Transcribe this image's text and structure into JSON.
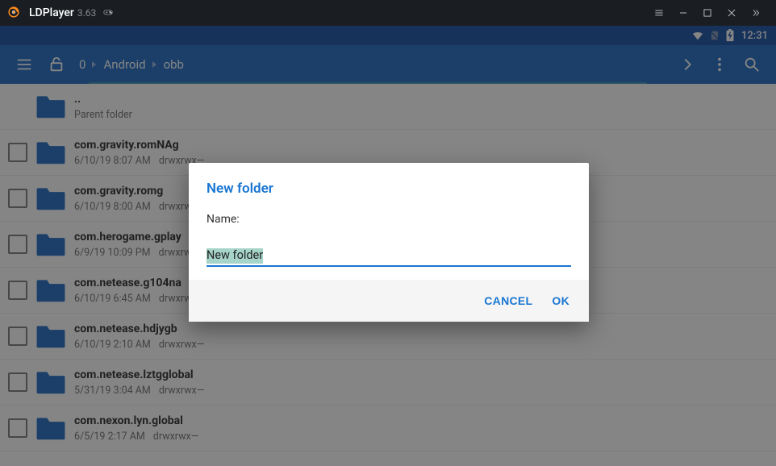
{
  "titlebar": {
    "appname": "LDPlayer",
    "version": "3.63"
  },
  "statusbar": {
    "time": "12:31"
  },
  "toolbar": {
    "breadcrumb": [
      "0",
      "Android",
      "obb"
    ]
  },
  "files": [
    {
      "name": "..",
      "sub1": "Parent folder",
      "sub2": "",
      "parent": true
    },
    {
      "name": "com.gravity.romNAg",
      "sub1": "6/10/19 8:07 AM",
      "sub2": "drwxrwx—"
    },
    {
      "name": "com.gravity.romg",
      "sub1": "6/10/19 8:00 AM",
      "sub2": "drwxrwx—"
    },
    {
      "name": "com.herogame.gplay",
      "sub1": "6/9/19 10:09 PM",
      "sub2": "drwxrwx—"
    },
    {
      "name": "com.netease.g104na",
      "sub1": "6/10/19 6:45 AM",
      "sub2": "drwxrwx—"
    },
    {
      "name": "com.netease.hdjygb",
      "sub1": "6/10/19 2:10 AM",
      "sub2": "drwxrwx—"
    },
    {
      "name": "com.netease.lztgglobal",
      "sub1": "5/31/19 3:04 AM",
      "sub2": "drwxrwx—"
    },
    {
      "name": "com.nexon.lyn.global",
      "sub1": "6/5/19 2:17 AM",
      "sub2": "drwxrwx—"
    }
  ],
  "dialog": {
    "title": "New folder",
    "label": "Name:",
    "value": "New folder",
    "cancel": "CANCEL",
    "ok": "OK"
  }
}
